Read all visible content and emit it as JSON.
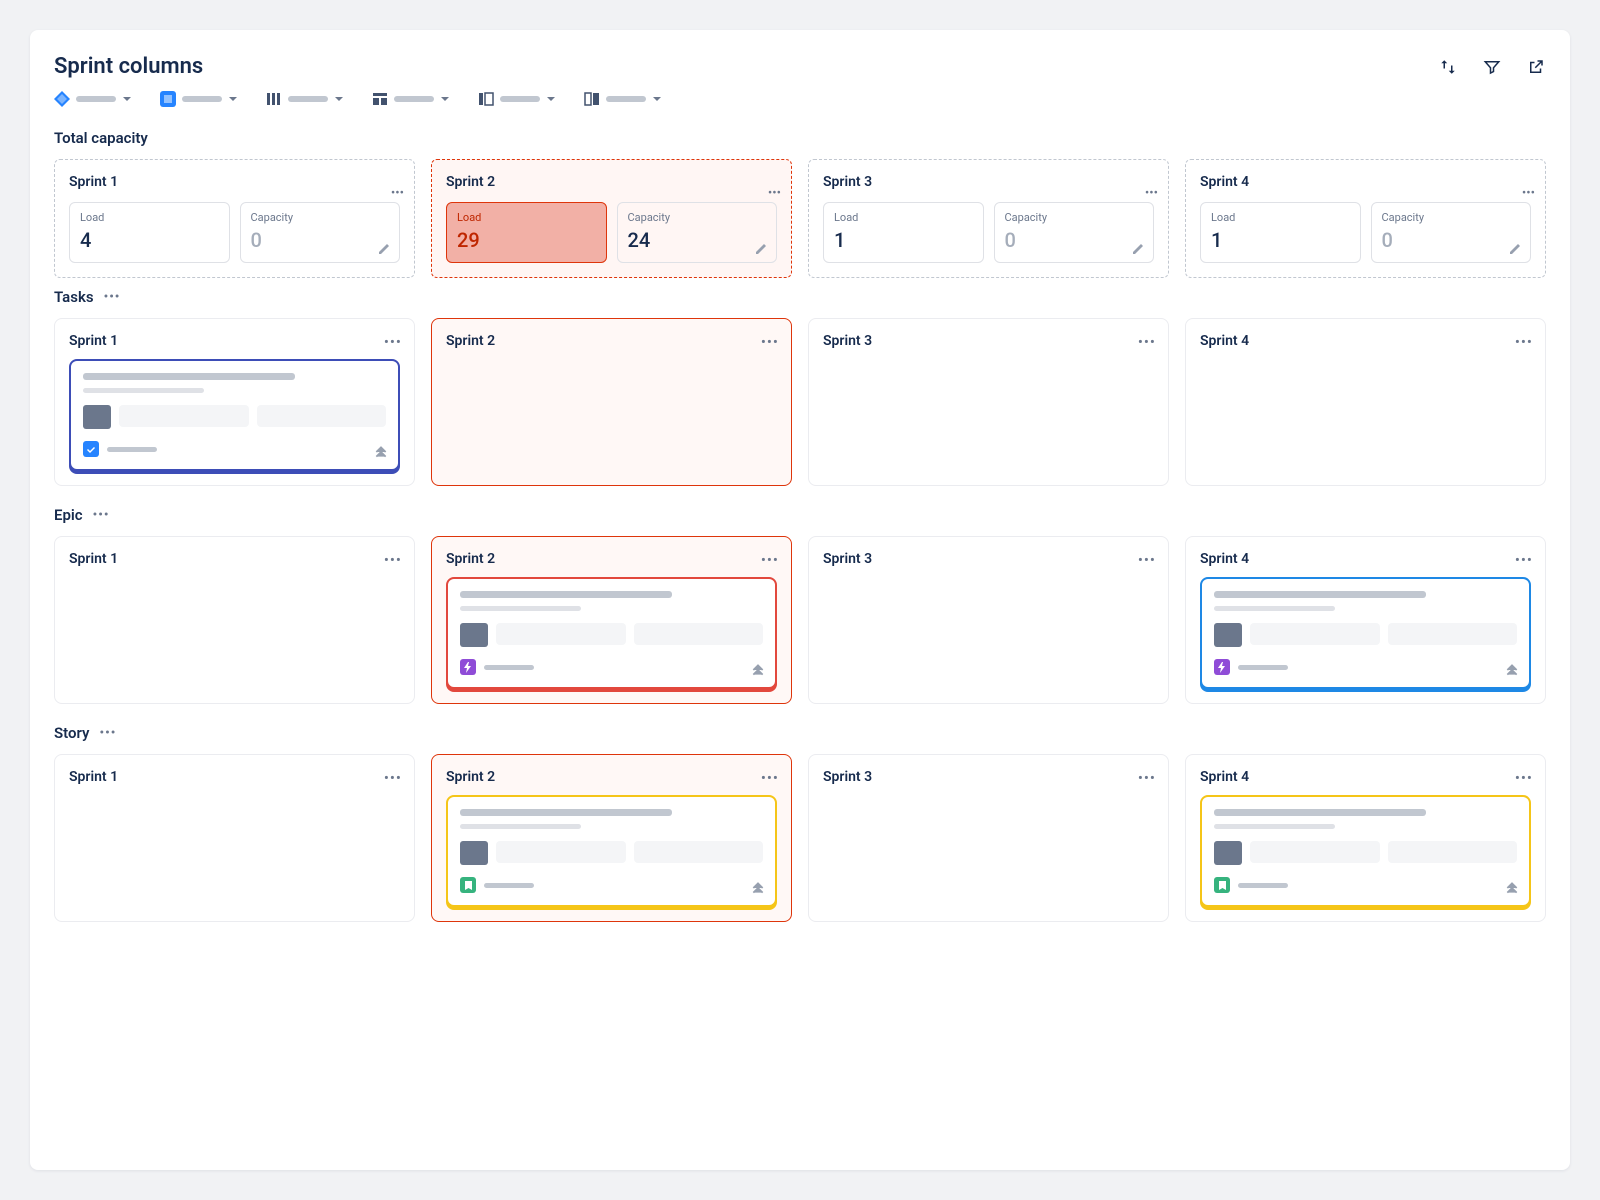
{
  "header": {
    "title": "Sprint columns",
    "icons": [
      "sort-icon",
      "filter-icon",
      "open-external-icon"
    ]
  },
  "toolbar": {
    "items": [
      {
        "icon": "jira-icon",
        "label": ""
      },
      {
        "icon": "app-icon",
        "label": ""
      },
      {
        "icon": "columns-icon",
        "label": ""
      },
      {
        "icon": "layout-icon",
        "label": ""
      },
      {
        "icon": "panel-left-icon",
        "label": ""
      },
      {
        "icon": "panel-split-icon",
        "label": ""
      }
    ]
  },
  "capacity": {
    "title": "Total capacity",
    "load_label": "Load",
    "capacity_label": "Capacity",
    "columns": [
      {
        "name": "Sprint 1",
        "load": "4",
        "capacity": "0",
        "over": false
      },
      {
        "name": "Sprint 2",
        "load": "29",
        "capacity": "24",
        "over": true
      },
      {
        "name": "Sprint 3",
        "load": "1",
        "capacity": "0",
        "over": false
      },
      {
        "name": "Sprint 4",
        "load": "1",
        "capacity": "0",
        "over": false
      }
    ]
  },
  "lanes": [
    {
      "title": "Tasks",
      "type": "task",
      "columns": [
        {
          "name": "Sprint 1",
          "over": false,
          "card": "indigo"
        },
        {
          "name": "Sprint 2",
          "over": true,
          "card": null
        },
        {
          "name": "Sprint 3",
          "over": false,
          "card": null
        },
        {
          "name": "Sprint 4",
          "over": false,
          "card": null
        }
      ]
    },
    {
      "title": "Epic",
      "type": "epic",
      "columns": [
        {
          "name": "Sprint 1",
          "over": false,
          "card": null
        },
        {
          "name": "Sprint 2",
          "over": true,
          "card": "red"
        },
        {
          "name": "Sprint 3",
          "over": false,
          "card": null
        },
        {
          "name": "Sprint 4",
          "over": false,
          "card": "blue"
        }
      ]
    },
    {
      "title": "Story",
      "type": "story",
      "columns": [
        {
          "name": "Sprint 1",
          "over": false,
          "card": null
        },
        {
          "name": "Sprint 2",
          "over": true,
          "card": "yellow"
        },
        {
          "name": "Sprint 3",
          "over": false,
          "card": null
        },
        {
          "name": "Sprint 4",
          "over": false,
          "card": "yellow"
        }
      ]
    }
  ]
}
